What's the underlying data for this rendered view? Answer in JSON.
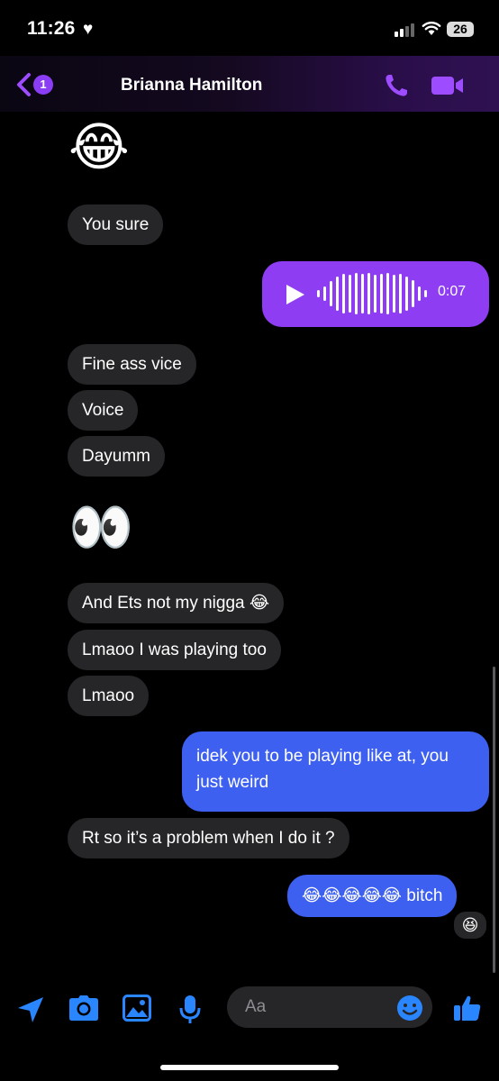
{
  "status_bar": {
    "time": "11:26",
    "heart": "♥",
    "battery": "26"
  },
  "header": {
    "unread_count": "1",
    "contact_name": "Brianna Hamilton"
  },
  "messages": [
    {
      "type": "emoji",
      "text": "😂"
    },
    {
      "type": "text_in",
      "text": "You sure"
    },
    {
      "type": "voice_out",
      "duration": "0:07"
    },
    {
      "type": "text_in",
      "text": "Fine ass vice"
    },
    {
      "type": "text_in",
      "text": "Voice"
    },
    {
      "type": "text_in",
      "text": "Dayumm"
    },
    {
      "type": "emoji",
      "text": "👀"
    },
    {
      "type": "text_in",
      "text": "And Ets not my nigga 😂"
    },
    {
      "type": "text_in",
      "text": "Lmaoo I was playing too"
    },
    {
      "type": "text_in",
      "text": "Lmaoo"
    },
    {
      "type": "text_out",
      "text": "idek you to be playing like at, you just weird"
    },
    {
      "type": "text_in",
      "text": "Rt so it’s a problem when I do it ?"
    },
    {
      "type": "text_out",
      "text": "😂😂😂😂😂 bitch",
      "reaction": "😆"
    }
  ],
  "composer": {
    "placeholder": "Aa"
  },
  "colors": {
    "accent_purple": "#8e3df3",
    "outgoing_blue": "#3d60f0",
    "incoming_gray": "#262628",
    "toolbar_blue": "#2a86ff"
  }
}
